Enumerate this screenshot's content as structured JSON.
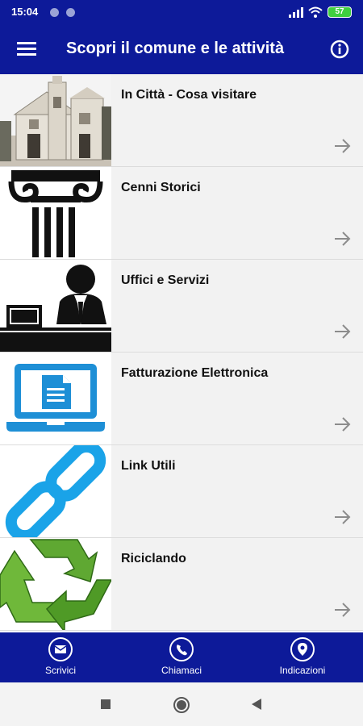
{
  "status_bar": {
    "time": "15:04",
    "battery": "57"
  },
  "app_bar": {
    "title": "Scopri il comune e le attività"
  },
  "items": [
    {
      "label": "In Città - Cosa visitare",
      "icon": "church-photo-icon"
    },
    {
      "label": "Cenni Storici",
      "icon": "column-icon"
    },
    {
      "label": "Uffici e Servizi",
      "icon": "office-clerk-icon"
    },
    {
      "label": "Fatturazione Elettronica",
      "icon": "laptop-document-icon"
    },
    {
      "label": "Link Utili",
      "icon": "chain-link-icon"
    },
    {
      "label": "Riciclando",
      "icon": "recycle-icon"
    }
  ],
  "bottom_nav": [
    {
      "label": "Scrivici",
      "icon": "mail-icon"
    },
    {
      "label": "Chiamaci",
      "icon": "phone-icon"
    },
    {
      "label": "Indicazioni",
      "icon": "location-pin-icon"
    }
  ],
  "colors": {
    "primary": "#0d1a99",
    "row_bg": "#f2f2f2",
    "link_blue": "#1aa3e8",
    "laptop_blue": "#1e8fd6",
    "recycle_green": "#5fa832"
  }
}
